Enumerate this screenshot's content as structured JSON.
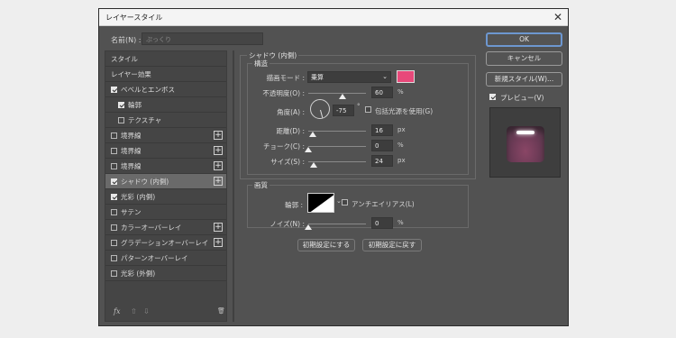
{
  "dialog": {
    "title": "レイヤースタイル",
    "close": "✕"
  },
  "name": {
    "label": "名前(N) :",
    "value": "ぷっくり"
  },
  "styles": [
    {
      "label": "スタイル",
      "checkbox": false,
      "checked": false,
      "plus": false,
      "indent": 0,
      "selected": false
    },
    {
      "label": "レイヤー効果",
      "checkbox": false,
      "checked": false,
      "plus": false,
      "indent": 0,
      "selected": false
    },
    {
      "label": "ベベルとエンボス",
      "checkbox": true,
      "checked": true,
      "plus": false,
      "indent": 0,
      "selected": false
    },
    {
      "label": "輪郭",
      "checkbox": true,
      "checked": true,
      "plus": false,
      "indent": 1,
      "selected": false
    },
    {
      "label": "テクスチャ",
      "checkbox": true,
      "checked": false,
      "plus": false,
      "indent": 1,
      "selected": false
    },
    {
      "label": "境界線",
      "checkbox": true,
      "checked": false,
      "plus": true,
      "indent": 0,
      "selected": false
    },
    {
      "label": "境界線",
      "checkbox": true,
      "checked": false,
      "plus": true,
      "indent": 0,
      "selected": false
    },
    {
      "label": "境界線",
      "checkbox": true,
      "checked": false,
      "plus": true,
      "indent": 0,
      "selected": false
    },
    {
      "label": "シャドウ (内側)",
      "checkbox": true,
      "checked": true,
      "plus": true,
      "indent": 0,
      "selected": true
    },
    {
      "label": "光彩 (内側)",
      "checkbox": true,
      "checked": true,
      "plus": false,
      "indent": 0,
      "selected": false
    },
    {
      "label": "サテン",
      "checkbox": true,
      "checked": false,
      "plus": false,
      "indent": 0,
      "selected": false
    },
    {
      "label": "カラーオーバーレイ",
      "checkbox": true,
      "checked": false,
      "plus": true,
      "indent": 0,
      "selected": false
    },
    {
      "label": "グラデーションオーバーレイ",
      "checkbox": true,
      "checked": false,
      "plus": true,
      "indent": 0,
      "selected": false
    },
    {
      "label": "パターンオーバーレイ",
      "checkbox": true,
      "checked": false,
      "plus": false,
      "indent": 0,
      "selected": false
    },
    {
      "label": "光彩 (外側)",
      "checkbox": true,
      "checked": false,
      "plus": false,
      "indent": 0,
      "selected": false
    }
  ],
  "footer": {
    "fx": "fx",
    "up": "⇧",
    "down": "⇩",
    "trash": "🗑"
  },
  "section": {
    "title": "シャドウ (内側)",
    "structure": "構造",
    "quality": "画質"
  },
  "structure": {
    "blend_label": "描画モード :",
    "blend_value": "乗算",
    "blend_color": "#e8497a",
    "opacity_label": "不透明度(O) :",
    "opacity_value": "60",
    "opacity_unit": "%",
    "opacity_level": 0.6,
    "angle_label": "角度(A) :",
    "angle_value": "-75",
    "angle_unit": "°",
    "global_light_label": "包括光源を使用(G)",
    "distance_label": "距離(D) :",
    "distance_value": "16",
    "distance_unit": "px",
    "distance_level": 0.08,
    "choke_label": "チョーク(C) :",
    "choke_value": "0",
    "choke_unit": "%",
    "choke_level": 0,
    "size_label": "サイズ(S) :",
    "size_value": "24",
    "size_unit": "px",
    "size_level": 0.1
  },
  "quality": {
    "contour_label": "輪郭 :",
    "antialias_label": "アンチエイリアス(L)",
    "noise_label": "ノイズ(N) :",
    "noise_value": "0",
    "noise_unit": "%",
    "noise_level": 0
  },
  "buttons": {
    "set_default": "初期設定にする",
    "reset_default": "初期設定に戻す"
  },
  "right": {
    "ok": "OK",
    "cancel": "キャンセル",
    "new_style": "新規スタイル(W)...",
    "preview_label": "プレビュー(V)"
  }
}
